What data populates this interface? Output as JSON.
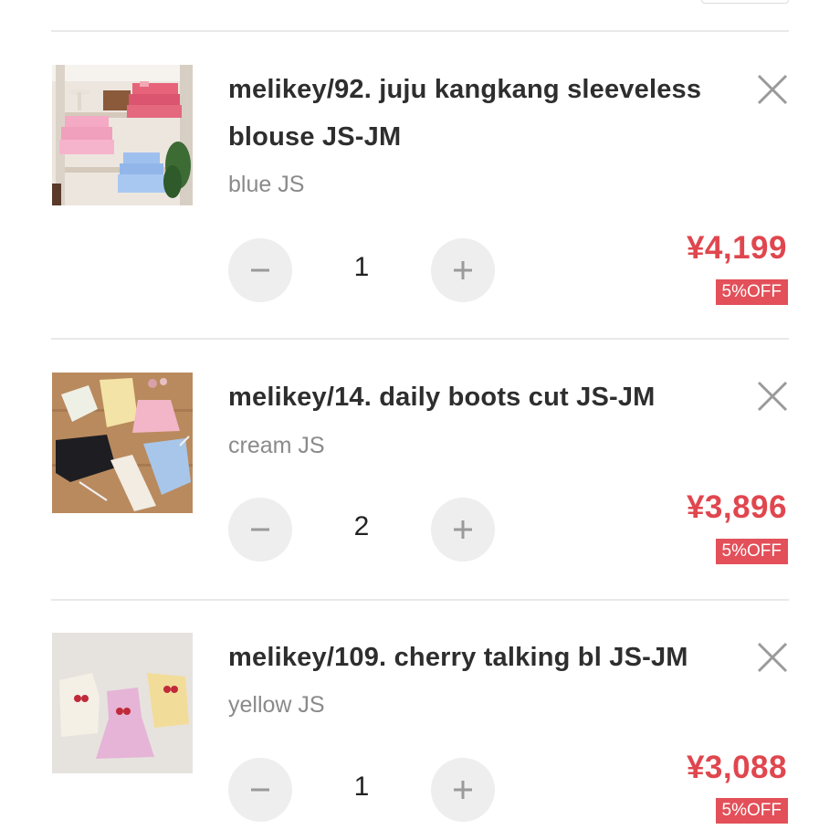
{
  "cart": {
    "items": [
      {
        "title": "melikey/92. juju kangkang sleeveless blouse JS-JM",
        "variant": "blue JS",
        "quantity": "1",
        "price": "¥4,199",
        "discount": "5%OFF",
        "thumbnail_icon": "product-photo-ruffle-blouses"
      },
      {
        "title": "melikey/14. daily boots cut JS-JM",
        "variant": "cream JS",
        "quantity": "2",
        "price": "¥3,896",
        "discount": "5%OFF",
        "thumbnail_icon": "product-photo-flared-pants"
      },
      {
        "title": "melikey/109. cherry talking bl JS-JM",
        "variant": "yellow JS",
        "quantity": "1",
        "price": "¥3,088",
        "discount": "5%OFF",
        "thumbnail_icon": "product-photo-cherry-tops"
      }
    ],
    "colors": {
      "price": "#e0464e",
      "badge": "#e35059",
      "stepper_bg": "#eeeeee"
    }
  }
}
